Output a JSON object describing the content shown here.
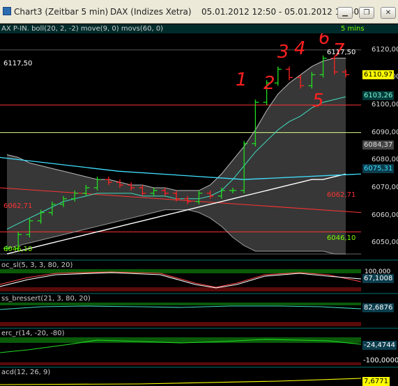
{
  "window": {
    "title": "Chart3 (Zeitbar 5 min)",
    "instrument": "DAX (Indizes Xetra)",
    "range": "05.01.2012 12:50 - 05.01.2012 14:50",
    "controls": [
      "minimize-icon",
      "restore-icon",
      "close-icon"
    ]
  },
  "main_header": {
    "text": "AX P-IN. boll(20, 2, -2) move(9, 0) movs(60, 0)",
    "timeframe": "5 mins"
  },
  "price_axis": {
    "ticks": [
      "6120,00",
      "6110,00",
      "6100,00",
      "6090,00",
      "6080,00",
      "6070,00",
      "6060,00",
      "6050,00"
    ],
    "tags": {
      "last_close": "6110,97",
      "bb_upper": "6103,26",
      "bb_mid": "6084,37",
      "ma": "6075,31"
    },
    "last_close_color": "#ffff00"
  },
  "chart_labels": {
    "high_left": "6117,50",
    "high_right": "6117,50",
    "red_level": "6062,71",
    "red_level_right": "6062,71",
    "low_left": "6046,10",
    "low_right": "6046,10"
  },
  "annotations": [
    "1",
    "2",
    "3",
    "4",
    "5",
    "6",
    "7"
  ],
  "chart_data": {
    "type": "line",
    "title": "DAX (Indizes Xetra)",
    "ylim": [
      6044,
      6126
    ],
    "candles_close": [
      6048,
      6053,
      6058,
      6061,
      6064,
      6066,
      6068,
      6070,
      6073,
      6072,
      6071,
      6070,
      6068,
      6069,
      6068,
      6066,
      6065,
      6068,
      6067,
      6069,
      6069,
      6086,
      6101,
      6108,
      6113,
      6110,
      6107,
      6111,
      6117,
      6112,
      6111
    ],
    "series": [
      {
        "name": "boll upper",
        "values": [
          6082,
          6081,
          6079,
          6078,
          6077,
          6076,
          6075,
          6074,
          6073,
          6073,
          6072,
          6071,
          6071,
          6070,
          6070,
          6069,
          6069,
          6069,
          6071,
          6075,
          6080,
          6085,
          6091,
          6098,
          6104,
          6108,
          6111,
          6114,
          6116,
          6117,
          6117
        ]
      },
      {
        "name": "boll lower",
        "values": [
          6048,
          6049,
          6050,
          6051,
          6052,
          6053,
          6054,
          6055,
          6056,
          6057,
          6058,
          6059,
          6060,
          6061,
          6062,
          6062,
          6062,
          6061,
          6059,
          6056,
          6052,
          6049,
          6047,
          6047,
          6047,
          6047,
          6047,
          6047,
          6047,
          6046,
          6046
        ]
      },
      {
        "name": "move(9)",
        "values": [
          6055,
          6057,
          6059,
          6061,
          6063,
          6065,
          6066,
          6067,
          6068,
          6068,
          6068,
          6068,
          6067,
          6067,
          6067,
          6066,
          6066,
          6066,
          6067,
          6069,
          6073,
          6078,
          6083,
          6087,
          6091,
          6094,
          6096,
          6099,
          6101,
          6102,
          6103
        ]
      },
      {
        "name": "movs(60)",
        "values": [
          6046,
          6047,
          6048,
          6049,
          6050,
          6051,
          6052,
          6053,
          6054,
          6055,
          6056,
          6057,
          6058,
          6059,
          6060,
          6061,
          6062,
          6063,
          6064,
          6065,
          6066,
          6067,
          6068,
          6069,
          6070,
          6071,
          6072,
          6073,
          6073,
          6074,
          6075
        ]
      }
    ]
  },
  "panels": [
    {
      "header": "oc_sl(5, 3, 3, 80, 20)",
      "value": "67,1008",
      "upper": "100,000",
      "tick_color": "#ffffff"
    },
    {
      "header": "ss_bressert(21, 3, 80, 20)",
      "value": "82,6876",
      "tick_color": "#ffffff"
    },
    {
      "header": "erc_r(14, -20, -80)",
      "value": "-24,4744",
      "lower": "-100,0000",
      "tick_color": "#ffffff"
    },
    {
      "header": "acd(12, 26, 9)",
      "value": "7,6771",
      "tick_color": "#ffff00"
    }
  ]
}
